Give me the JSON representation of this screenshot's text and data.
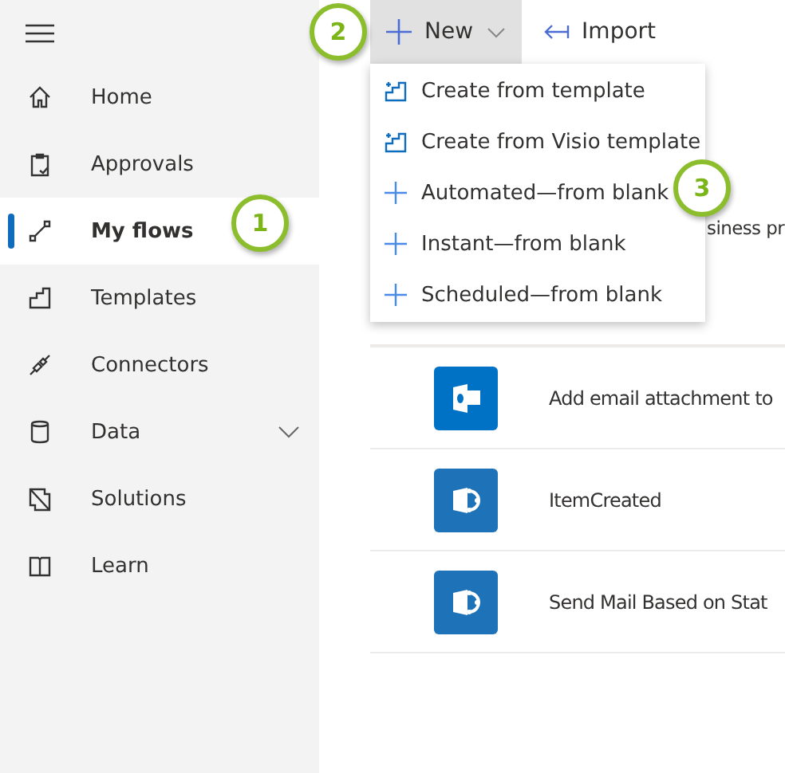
{
  "sidebar": {
    "items": [
      {
        "label": "Home",
        "selected": false
      },
      {
        "label": "Approvals",
        "selected": false
      },
      {
        "label": "My flows",
        "selected": true
      },
      {
        "label": "Templates",
        "selected": false
      },
      {
        "label": "Connectors",
        "selected": false
      },
      {
        "label": "Data",
        "selected": false,
        "expanded": false
      },
      {
        "label": "Solutions",
        "selected": false
      },
      {
        "label": "Learn",
        "selected": false
      }
    ]
  },
  "toolbar": {
    "new_button": {
      "label": "New",
      "expanded": true
    },
    "import_button": {
      "label": "Import"
    }
  },
  "new_menu": [
    {
      "label": "Create from template",
      "kind": "template"
    },
    {
      "label": "Create from Visio template",
      "kind": "template"
    },
    {
      "label": "Automated—from blank",
      "kind": "blank"
    },
    {
      "label": "Instant—from blank",
      "kind": "blank"
    },
    {
      "label": "Scheduled—from blank",
      "kind": "blank"
    }
  ],
  "partial_text": "siness pr",
  "flows": [
    {
      "name": "Add email attachment to",
      "kind": "mail"
    },
    {
      "name": "ItemCreated",
      "kind": "site"
    },
    {
      "name": "Send Mail Based on Stat",
      "kind": "site"
    }
  ],
  "callouts": [
    "1",
    "2",
    "3"
  ]
}
